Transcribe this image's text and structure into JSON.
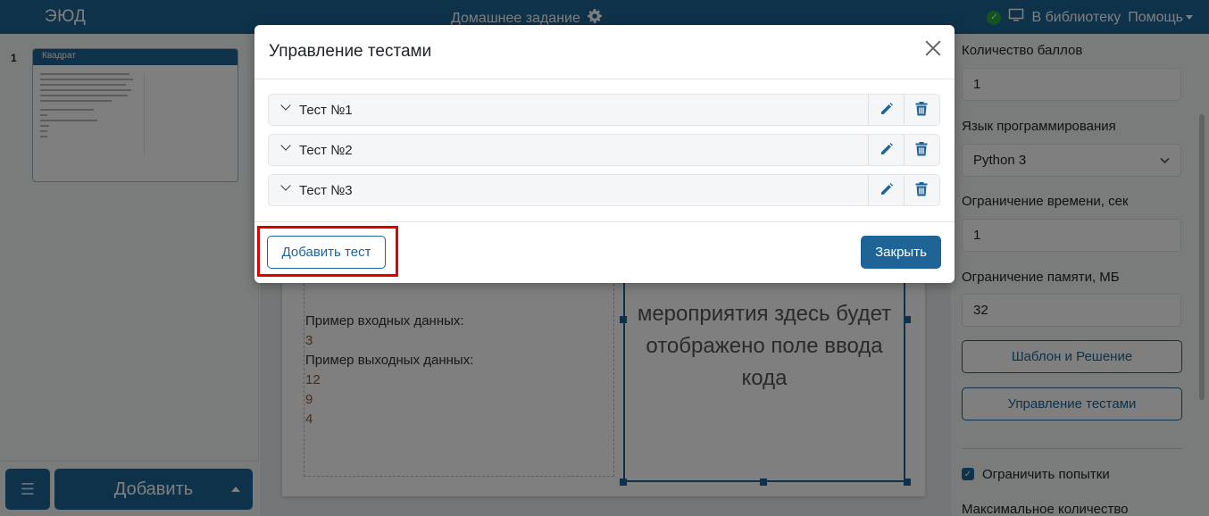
{
  "navbar": {
    "logo": "ЭЮД",
    "title": "Домашнее задание",
    "library_link": "В библиотеку",
    "help_link": "Помощь"
  },
  "left_panel": {
    "slide_number": "1",
    "slide_title": "Квадрат",
    "add_button": "Добавить"
  },
  "slide": {
    "input_label": "Пример входных данных:",
    "input_value": "3",
    "output_label": "Пример выходных данных:",
    "output_values": [
      "12",
      "9",
      "4"
    ],
    "code_placeholder": "мероприятия здесь будет отображено поле ввода кода"
  },
  "right_panel": {
    "points_label": "Количество баллов",
    "points_value": "1",
    "language_label": "Язык программирования",
    "language_value": "Python 3",
    "time_label": "Ограничение времени, сек",
    "time_value": "1",
    "memory_label": "Ограничение памяти, МБ",
    "memory_value": "32",
    "template_button": "Шаблон и Решение",
    "tests_button": "Управление тестами",
    "limit_attempts_label": "Ограничить попытки",
    "max_count_label": "Максимальное количество"
  },
  "modal": {
    "title": "Управление тестами",
    "tests": [
      {
        "label": "Тест №1"
      },
      {
        "label": "Тест №2"
      },
      {
        "label": "Тест №3"
      }
    ],
    "add_test_button": "Добавить тест",
    "close_button": "Закрыть"
  },
  "colors": {
    "primary": "#1f6496",
    "highlight": "#e00000",
    "success": "#28a745"
  },
  "icons": [
    "gear-icon",
    "check-circle-icon",
    "monitor-icon",
    "list-icon",
    "chevron-down-icon",
    "pencil-icon",
    "trash-icon",
    "close-icon"
  ]
}
